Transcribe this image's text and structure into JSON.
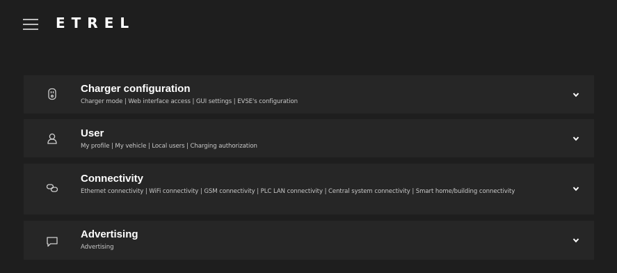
{
  "header": {
    "logo_text": "ETREL",
    "menu_icon": "hamburger-menu-icon"
  },
  "sections": [
    {
      "title": "Charger configuration",
      "subtitle": "Charger mode | Web interface access | GUI settings | EVSE's configuration",
      "icon": "charger-plug-icon"
    },
    {
      "title": "User",
      "subtitle": "My profile | My vehicle | Local users | Charging authorization",
      "icon": "user-icon"
    },
    {
      "title": "Connectivity",
      "subtitle": "Ethernet connectivity | WiFi connectivity | GSM connectivity | PLC LAN connectivity | Central system connectivity | Smart home/building connectivity",
      "icon": "link-icon"
    },
    {
      "title": "Advertising",
      "subtitle": "Advertising",
      "icon": "chat-bubble-icon"
    }
  ],
  "colors": {
    "background": "#1e1e1e",
    "panel": "#262626",
    "text": "#ffffff",
    "subtext": "#c8c8c8"
  }
}
